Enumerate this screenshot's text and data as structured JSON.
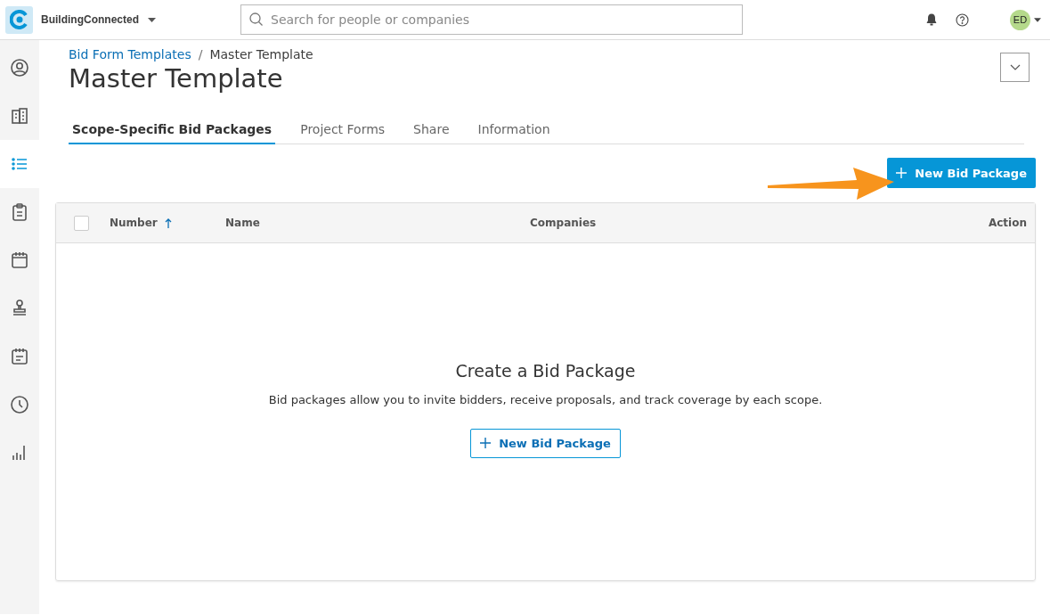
{
  "app_bar": {
    "app_name": "BuildingConnected",
    "search": {
      "placeholder": "Search for people or companies"
    },
    "avatar": {
      "initials": "ED",
      "color": "#b5d98b"
    }
  },
  "sidebar": {
    "items": [
      {
        "kind": "person",
        "selected": false
      },
      {
        "kind": "building",
        "selected": false
      },
      {
        "kind": "list",
        "selected": true
      },
      {
        "kind": "clipboard",
        "selected": false
      },
      {
        "kind": "calendar",
        "selected": false
      },
      {
        "kind": "stamp",
        "selected": false
      },
      {
        "kind": "schedule",
        "selected": false
      },
      {
        "kind": "clock",
        "selected": false
      },
      {
        "kind": "chart",
        "selected": false
      }
    ]
  },
  "breadcrumb": [
    {
      "label": "Bid Form Templates",
      "kind": "link"
    },
    {
      "label": "/",
      "kind": "separator"
    },
    {
      "label": "Master Template",
      "kind": "current"
    }
  ],
  "title": "Master Template",
  "tabs": [
    {
      "label": "Scope-Specific Bid Packages",
      "selected": true
    },
    {
      "label": "Project Forms",
      "selected": false
    },
    {
      "label": "Share",
      "selected": false
    },
    {
      "label": "Information",
      "selected": false
    }
  ],
  "primary_button": "New Bid Package",
  "table": {
    "select_all_checked": false,
    "columns": [
      {
        "label": "Number",
        "sorted": true
      },
      {
        "label": "Name",
        "sorted": false
      },
      {
        "label": "Companies",
        "sorted": false
      },
      {
        "label": "Action",
        "sorted": false
      }
    ]
  },
  "empty_state": {
    "title": "Create a Bid Package",
    "text": "Bid packages allow you to invite bidders, receive proposals, and track coverage by each scope.",
    "button": "New Bid Package"
  }
}
